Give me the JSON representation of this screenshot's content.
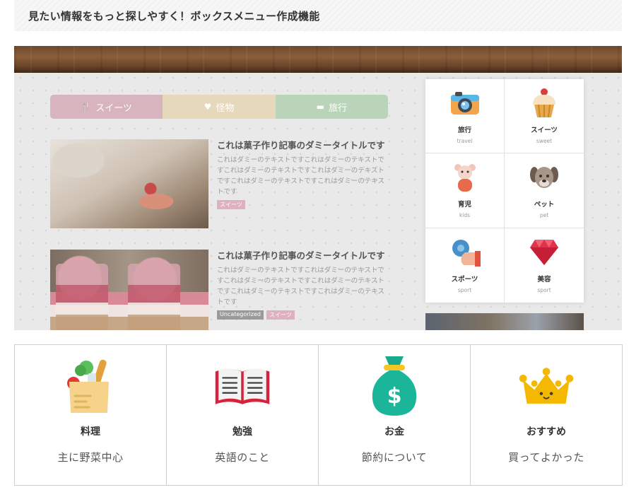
{
  "heading": {
    "title": "見たい情報をもっと探しやすく！ボックスメニュー作成機能"
  },
  "preview": {
    "tabs": [
      {
        "label": "スイーツ",
        "icon": "cutlery-icon",
        "color": "#d7b4be"
      },
      {
        "label": "怪物",
        "icon": "heart-icon",
        "color": "#e6d8bb"
      },
      {
        "label": "旅行",
        "icon": "suitcase-icon",
        "color": "#b9d4b9"
      }
    ],
    "articles": [
      {
        "title": "これは菓子作り記事のダミータイトルです",
        "text": "これはダミーのテキストですこれはダミーのテキストですこれはダミーのテキストですこれはダミーのテキストですこれはダミーのテキストですこれはダミーのテキストです",
        "tags": [
          "スイーツ"
        ]
      },
      {
        "title": "これは菓子作り記事のダミータイトルです",
        "text": "これはダミーのテキストですこれはダミーのテキストですこれはダミーのテキストですこれはダミーのテキストですこれはダミーのテキストですこれはダミーのテキストです",
        "tags": [
          "Uncategorized",
          "スイーツ"
        ]
      }
    ],
    "mini_menu": [
      {
        "title": "旅行",
        "sub": "travel",
        "icon": "camera-icon"
      },
      {
        "title": "スイーツ",
        "sub": "sweet",
        "icon": "cupcake-icon"
      },
      {
        "title": "育児",
        "sub": "kids",
        "icon": "teddy-bear-icon"
      },
      {
        "title": "ペット",
        "sub": "pet",
        "icon": "dog-icon"
      },
      {
        "title": "スポーツ",
        "sub": "sport",
        "icon": "sport-hand-icon"
      },
      {
        "title": "美容",
        "sub": "sport",
        "icon": "gem-icon"
      }
    ]
  },
  "box_menu": [
    {
      "title": "料理",
      "sub": "主に野菜中心",
      "icon": "grocery-bag-icon"
    },
    {
      "title": "勉強",
      "sub": "英語のこと",
      "icon": "open-book-icon"
    },
    {
      "title": "お金",
      "sub": "節約について",
      "icon": "money-bag-icon"
    },
    {
      "title": "おすすめ",
      "sub": "買ってよかった",
      "icon": "crown-icon"
    }
  ]
}
